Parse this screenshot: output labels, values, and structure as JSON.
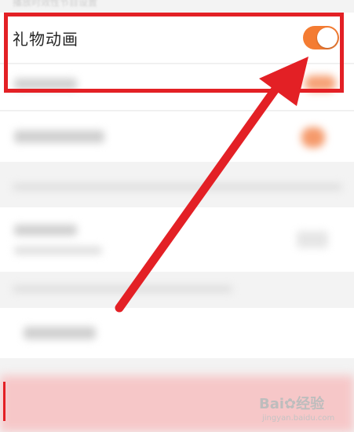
{
  "top_hint": "播放时效性节目设置",
  "gift_row": {
    "label": "礼物动画",
    "toggle_on": true,
    "toggle_color": "#f47c32"
  },
  "annotation": {
    "box_color": "#e32025",
    "arrow_color": "#e32025"
  },
  "watermark": {
    "brand": "Bai",
    "brand_suffix": "经验",
    "url": "jingyan.baidu.com"
  }
}
